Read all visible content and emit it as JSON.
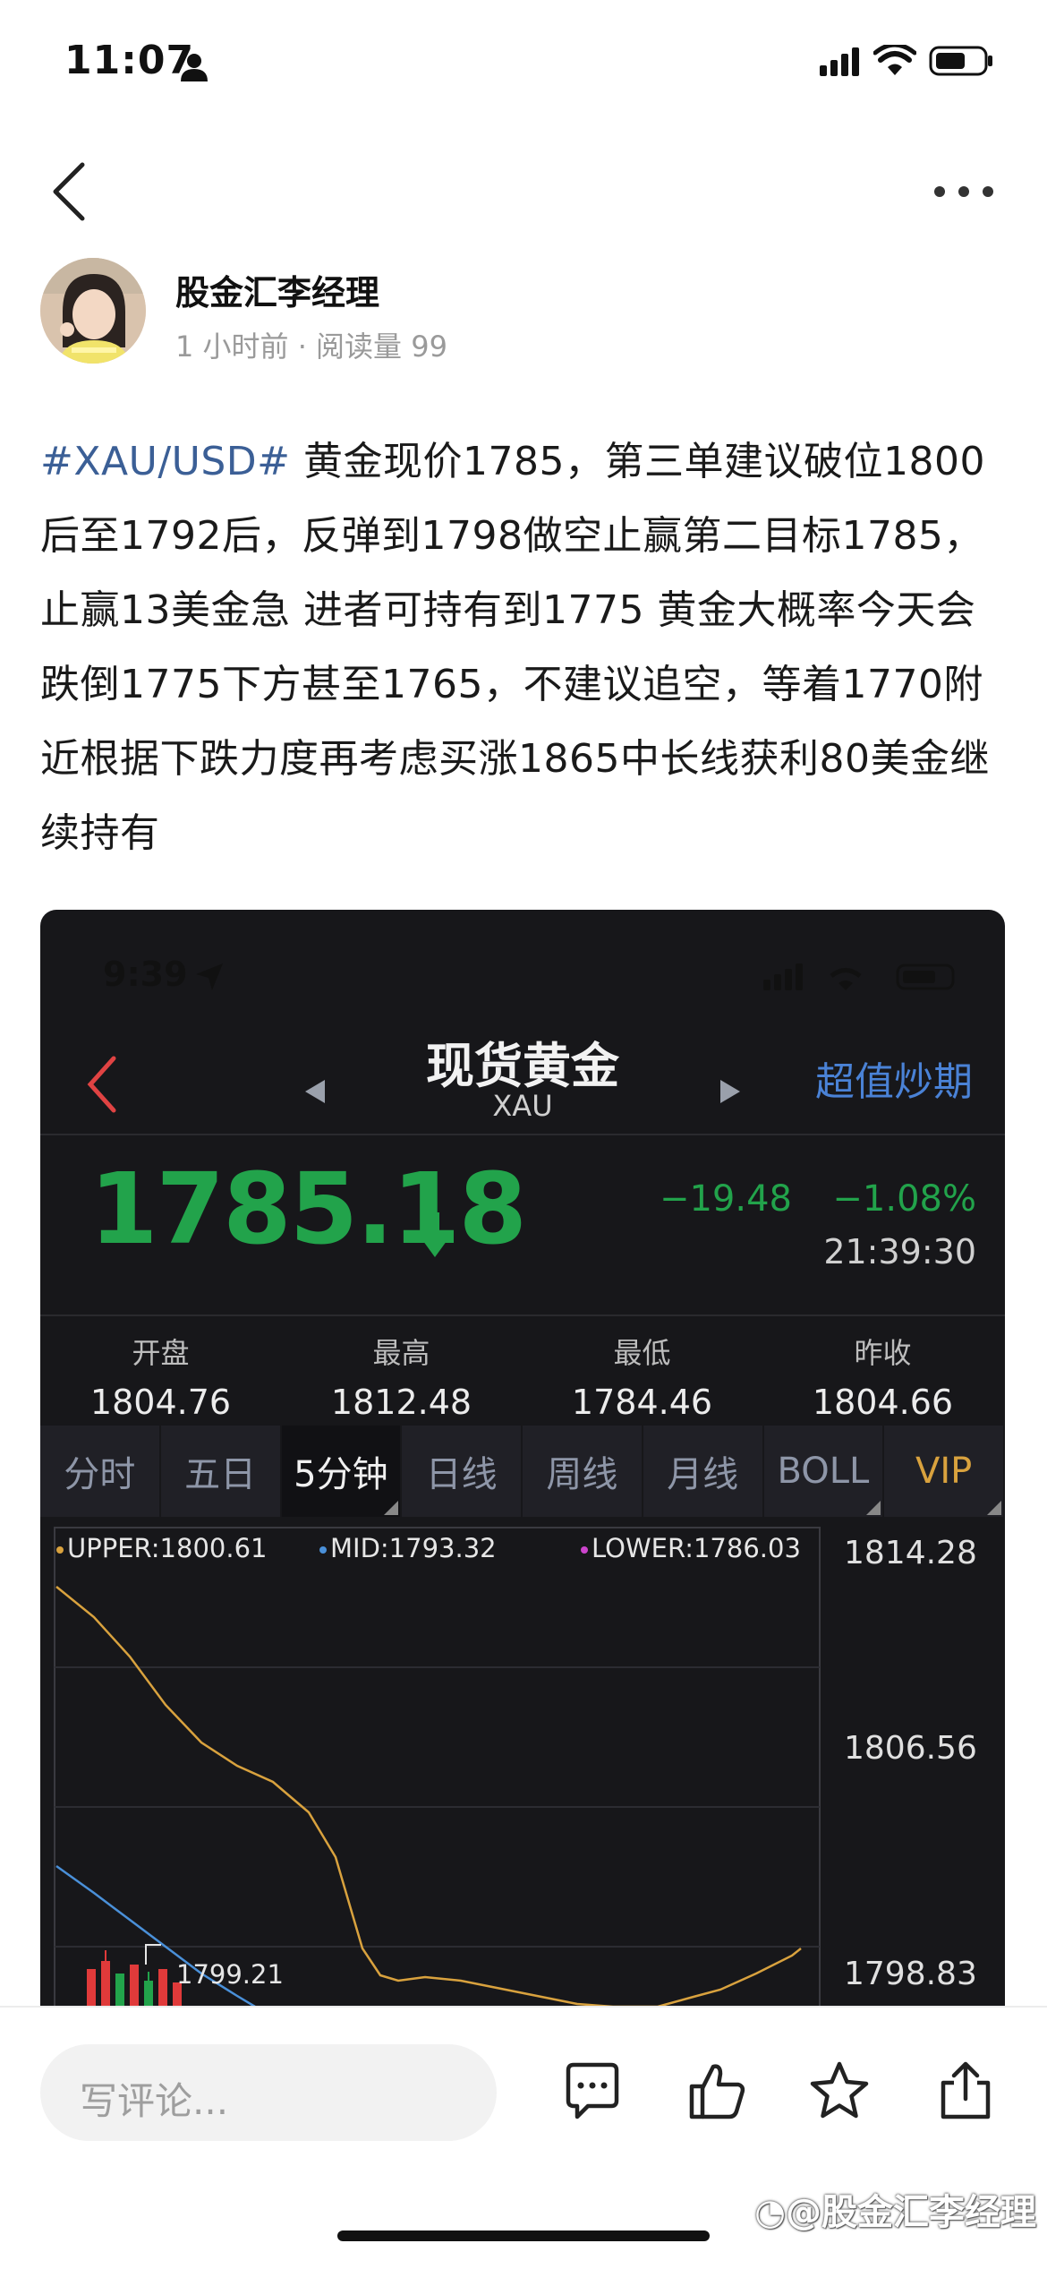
{
  "status_bar": {
    "time": "11:07"
  },
  "author": {
    "name": "股金汇李经理",
    "meta": "1 小时前 · 阅读量 99"
  },
  "post": {
    "hashtag": "#XAU/USD#",
    "body": " 黄金现价1785，第三单建议破位1800后至1792后，反弹到1798做空止赢第二目标1785，止赢13美金急 进者可持有到1775 黄金大概率今天会跌倒1775下方甚至1765，不建议追空，等着1770附近根据下跌力度再考虑买涨1865中长线获利80美金继续持有"
  },
  "embedded": {
    "status_time": "9:39",
    "title": "现货黄金",
    "subtitle": "XAU",
    "promo": "超值炒期",
    "price": "1785.18",
    "change": "−19.48",
    "change_pct": "−1.08%",
    "clock": "21:39:30",
    "stats": [
      {
        "label": "开盘",
        "value": "1804.76"
      },
      {
        "label": "最高",
        "value": "1812.48"
      },
      {
        "label": "最低",
        "value": "1784.46"
      },
      {
        "label": "昨收",
        "value": "1804.66"
      }
    ],
    "tabs": [
      "分时",
      "五日",
      "5分钟",
      "日线",
      "周线",
      "月线",
      "BOLL",
      "VIP"
    ],
    "legend": {
      "upper": "UPPER:1800.61",
      "mid": "MID:1793.32",
      "lower": "LOWER:1786.03"
    },
    "y_labels": [
      "1814.28",
      "1806.56",
      "1798.83"
    ],
    "candle_label": "1799.21",
    "colors": {
      "up": "#22a34b",
      "accent": "#4a82d6",
      "upper": "#d9a23e",
      "mid": "#4a90d9",
      "lower": "#cc44cc"
    }
  },
  "comment": {
    "placeholder": "写评论..."
  },
  "watermark": "@股金汇李经理"
}
